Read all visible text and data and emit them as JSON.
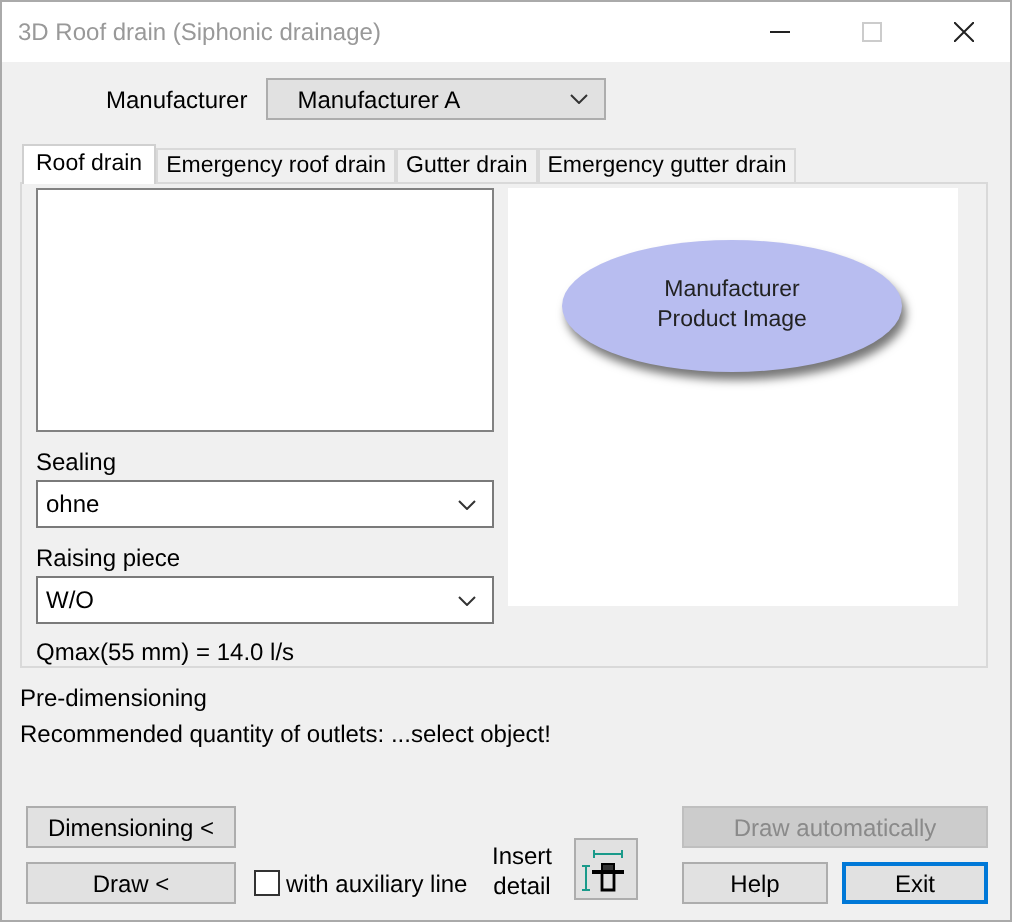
{
  "window": {
    "title": "3D Roof drain (Siphonic drainage)",
    "maximize_disabled": true
  },
  "manufacturer": {
    "label": "Manufacturer",
    "value": "Manufacturer A"
  },
  "tabs": [
    {
      "label": "Roof drain",
      "selected": true
    },
    {
      "label": "Emergency roof drain",
      "selected": false
    },
    {
      "label": "Gutter drain",
      "selected": false
    },
    {
      "label": "Emergency gutter drain",
      "selected": false
    }
  ],
  "sealing": {
    "label": "Sealing",
    "value": "ohne"
  },
  "raising_piece": {
    "label": "Raising piece",
    "value": "W/O"
  },
  "qmax": "Qmax(55 mm) = 14.0 l/s",
  "product_image": {
    "text_lines": [
      "Manufacturer",
      "Product Image"
    ]
  },
  "pre_dimensioning": {
    "title": "Pre-dimensioning",
    "recommendation": "Recommended quantity of outlets: ...select object!"
  },
  "buttons": [
    {
      "label": "Dimensioning <",
      "disabled": false,
      "focused": false
    },
    {
      "label": "Draw <",
      "disabled": false,
      "focused": false
    },
    {
      "label": "Draw automatically",
      "disabled": true,
      "focused": false
    },
    {
      "label": "Help",
      "disabled": false,
      "focused": false
    },
    {
      "label": "Exit",
      "disabled": false,
      "focused": true
    }
  ],
  "auxiliary_line": {
    "label": "with auxiliary line",
    "checked": false
  },
  "insert_detail": {
    "label": "Insert detail"
  }
}
